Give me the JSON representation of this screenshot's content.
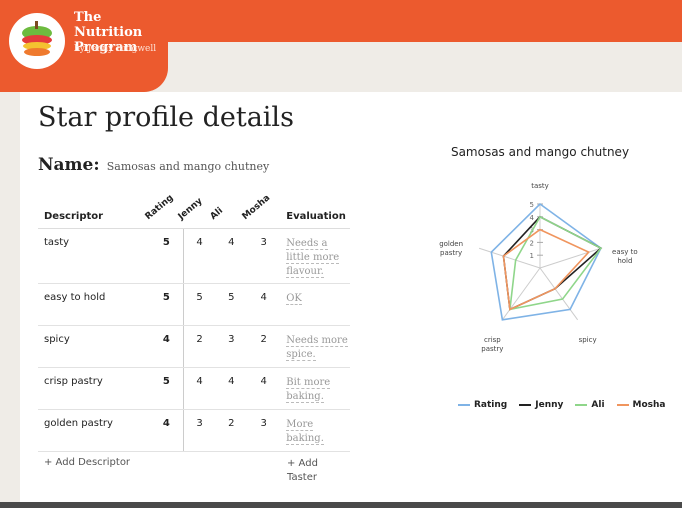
{
  "brand": {
    "title": "The Nutrition Program",
    "subtitle": "by Jenny Ridgwell"
  },
  "page": {
    "title": "Star profile details",
    "name_label": "Name:",
    "name_value": "Samosas and mango chutney"
  },
  "table": {
    "headers": {
      "descriptor": "Descriptor",
      "rating": "Rating",
      "tasters": [
        "Jenny",
        "Ali",
        "Mosha"
      ],
      "evaluation": "Evaluation"
    },
    "rows": [
      {
        "descriptor": "tasty",
        "rating": "5",
        "scores": [
          "4",
          "4",
          "3"
        ],
        "evaluation": "Needs a little more flavour."
      },
      {
        "descriptor": "easy to hold",
        "rating": "5",
        "scores": [
          "5",
          "5",
          "4"
        ],
        "evaluation": "OK"
      },
      {
        "descriptor": "spicy",
        "rating": "4",
        "scores": [
          "2",
          "3",
          "2"
        ],
        "evaluation": "Needs more spice."
      },
      {
        "descriptor": "crisp pastry",
        "rating": "5",
        "scores": [
          "4",
          "4",
          "4"
        ],
        "evaluation": "Bit more baking."
      },
      {
        "descriptor": "golden pastry",
        "rating": "4",
        "scores": [
          "3",
          "2",
          "3"
        ],
        "evaluation": "More baking."
      }
    ],
    "add_descriptor": "+ Add Descriptor",
    "add_taster": "+ Add Taster"
  },
  "chart_data": {
    "type": "radar",
    "title": "Samosas and mango chutney",
    "axes": [
      "tasty",
      "easy to hold",
      "spicy",
      "crisp pastry",
      "golden pastry"
    ],
    "axis_labels": [
      "tasty",
      "easy to hold",
      "spicy",
      "crisp pastry",
      "golden pastry"
    ],
    "range": [
      0,
      5
    ],
    "ticks": [
      "1",
      "2",
      "3",
      "4",
      "5"
    ],
    "legend_position": "bottom",
    "series": [
      {
        "name": "Rating",
        "color": "#7fb3e6",
        "values": [
          5,
          5,
          4,
          5,
          4
        ]
      },
      {
        "name": "Jenny",
        "color": "#222222",
        "values": [
          4,
          5,
          2,
          4,
          3
        ]
      },
      {
        "name": "Ali",
        "color": "#8fd68a",
        "values": [
          4,
          5,
          3,
          4,
          2
        ]
      },
      {
        "name": "Mosha",
        "color": "#f0955e",
        "values": [
          3,
          4,
          2,
          4,
          3
        ]
      }
    ]
  }
}
